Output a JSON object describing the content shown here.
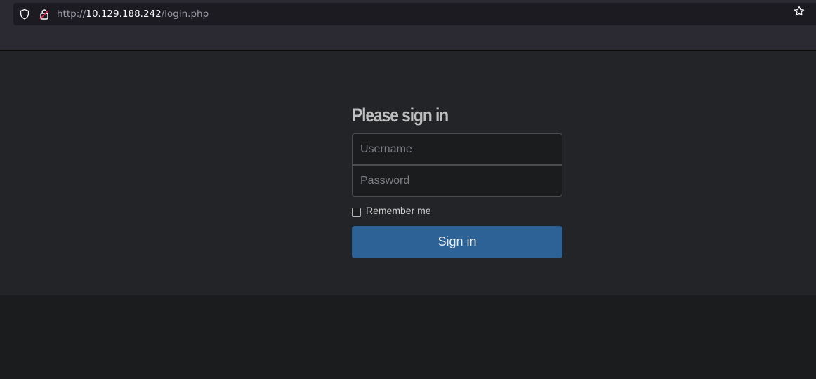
{
  "browser": {
    "url_scheme": "http://",
    "url_host": "10.129.188.242",
    "url_path": "/login.php",
    "icons": [
      "shield-icon",
      "lock-insecure-icon",
      "bookmark-star-icon"
    ]
  },
  "login_form": {
    "heading": "Please sign in",
    "username_placeholder": "Username",
    "username_value": "",
    "password_placeholder": "Password",
    "password_value": "",
    "remember_label": "Remember me",
    "remember_checked": false,
    "submit_label": "Sign in"
  },
  "colors": {
    "page_bg": "#222427",
    "button_bg": "#2c6296",
    "heading": "#bfbfbf"
  }
}
